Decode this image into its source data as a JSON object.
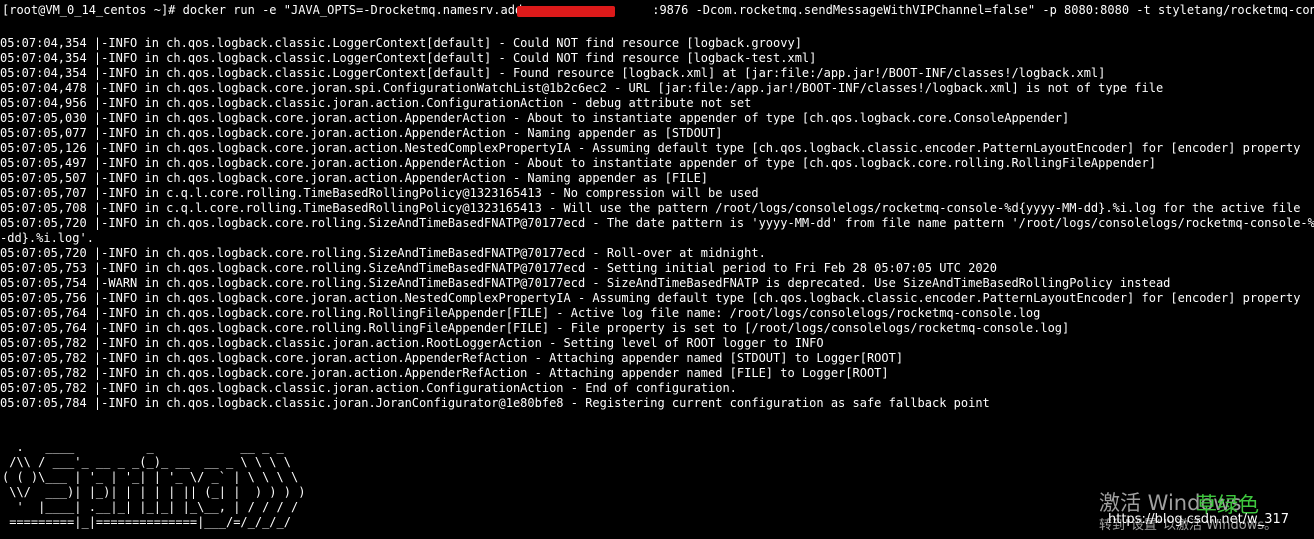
{
  "command_line": "[root@VM_0_14_centos ~]# docker run -e \"JAVA_OPTS=-Drocketmq.namesrv.addr=                :9876 -Dcom.rocketmq.sendMessageWithVIPChannel=false\" -p 8080:8080 -t styletang/rocketmq-console-ng",
  "log_lines": [
    "05:07:04,354 |-INFO in ch.qos.logback.classic.LoggerContext[default] - Could NOT find resource [logback.groovy]",
    "05:07:04,354 |-INFO in ch.qos.logback.classic.LoggerContext[default] - Could NOT find resource [logback-test.xml]",
    "05:07:04,354 |-INFO in ch.qos.logback.classic.LoggerContext[default] - Found resource [logback.xml] at [jar:file:/app.jar!/BOOT-INF/classes!/logback.xml]",
    "05:07:04,478 |-INFO in ch.qos.logback.core.joran.spi.ConfigurationWatchList@1b2c6ec2 - URL [jar:file:/app.jar!/BOOT-INF/classes!/logback.xml] is not of type file",
    "05:07:04,956 |-INFO in ch.qos.logback.classic.joran.action.ConfigurationAction - debug attribute not set",
    "05:07:05,030 |-INFO in ch.qos.logback.core.joran.action.AppenderAction - About to instantiate appender of type [ch.qos.logback.core.ConsoleAppender]",
    "05:07:05,077 |-INFO in ch.qos.logback.core.joran.action.AppenderAction - Naming appender as [STDOUT]",
    "05:07:05,126 |-INFO in ch.qos.logback.core.joran.action.NestedComplexPropertyIA - Assuming default type [ch.qos.logback.classic.encoder.PatternLayoutEncoder] for [encoder] property",
    "05:07:05,497 |-INFO in ch.qos.logback.core.joran.action.AppenderAction - About to instantiate appender of type [ch.qos.logback.core.rolling.RollingFileAppender]",
    "05:07:05,507 |-INFO in ch.qos.logback.core.joran.action.AppenderAction - Naming appender as [FILE]",
    "05:07:05,707 |-INFO in c.q.l.core.rolling.TimeBasedRollingPolicy@1323165413 - No compression will be used",
    "05:07:05,708 |-INFO in c.q.l.core.rolling.TimeBasedRollingPolicy@1323165413 - Will use the pattern /root/logs/consolelogs/rocketmq-console-%d{yyyy-MM-dd}.%i.log for the active file",
    "05:07:05,720 |-INFO in ch.qos.logback.core.rolling.SizeAndTimeBasedFNATP@70177ecd - The date pattern is 'yyyy-MM-dd' from file name pattern '/root/logs/consolelogs/rocketmq-console-%d{yyyy",
    "-dd}.%i.log'.",
    "05:07:05,720 |-INFO in ch.qos.logback.core.rolling.SizeAndTimeBasedFNATP@70177ecd - Roll-over at midnight.",
    "05:07:05,753 |-INFO in ch.qos.logback.core.rolling.SizeAndTimeBasedFNATP@70177ecd - Setting initial period to Fri Feb 28 05:07:05 UTC 2020",
    "05:07:05,754 |-WARN in ch.qos.logback.core.rolling.SizeAndTimeBasedFNATP@70177ecd - SizeAndTimeBasedFNATP is deprecated. Use SizeAndTimeBasedRollingPolicy instead",
    "05:07:05,756 |-INFO in ch.qos.logback.core.joran.action.NestedComplexPropertyIA - Assuming default type [ch.qos.logback.classic.encoder.PatternLayoutEncoder] for [encoder] property",
    "05:07:05,764 |-INFO in ch.qos.logback.core.rolling.RollingFileAppender[FILE] - Active log file name: /root/logs/consolelogs/rocketmq-console.log",
    "05:07:05,764 |-INFO in ch.qos.logback.core.rolling.RollingFileAppender[FILE] - File property is set to [/root/logs/consolelogs/rocketmq-console.log]",
    "05:07:05,782 |-INFO in ch.qos.logback.classic.joran.action.RootLoggerAction - Setting level of ROOT logger to INFO",
    "05:07:05,782 |-INFO in ch.qos.logback.core.joran.action.AppenderRefAction - Attaching appender named [STDOUT] to Logger[ROOT]",
    "05:07:05,782 |-INFO in ch.qos.logback.core.joran.action.AppenderRefAction - Attaching appender named [FILE] to Logger[ROOT]",
    "05:07:05,782 |-INFO in ch.qos.logback.classic.joran.action.ConfigurationAction - End of configuration.",
    "05:07:05,784 |-INFO in ch.qos.logback.classic.joran.JoranConfigurator@1e80bfe8 - Registering current configuration as safe fallback point"
  ],
  "banner_lines": [
    "  .   ____          _            __ _ _",
    " /\\\\ / ___'_ __ _ _(_)_ __  __ _ \\ \\ \\ \\",
    "( ( )\\___ | '_ | '_| | '_ \\/ _` | \\ \\ \\ \\",
    " \\\\/  ___)| |_)| | | | | || (_| |  ) ) ) )",
    "  '  |____| .__|_| |_|_| |_\\__, | / / / /",
    " =========|_|==============|___/=/_/_/_/"
  ],
  "watermark": {
    "activate_text": "激活 Windows",
    "activate_sub": "转到\"设置\"以激活 Windows。",
    "green_text": "草绿色",
    "url": "https://blog.csdn.net/w_317"
  },
  "colors": {
    "background": "#000000",
    "text": "#ffffff",
    "redaction": "#dd1a1a",
    "watermark_green": "#3ec83e"
  }
}
